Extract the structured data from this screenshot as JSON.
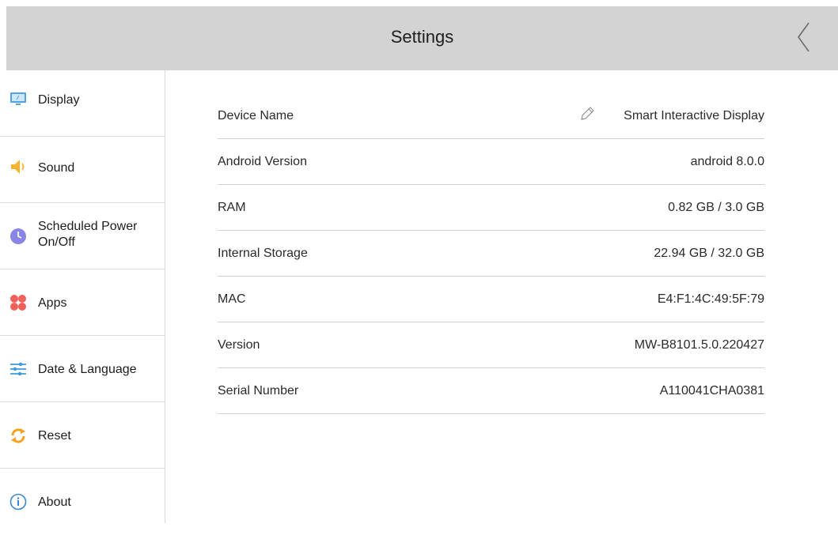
{
  "header": {
    "title": "Settings",
    "back_icon": "chevron-left-icon"
  },
  "sidebar": {
    "items": [
      {
        "label": "Display",
        "icon": "monitor-icon"
      },
      {
        "label": "Sound",
        "icon": "speaker-icon"
      },
      {
        "label": "Scheduled Power On/Off",
        "label_line1": "Scheduled Power",
        "label_line2": "On/Off",
        "icon": "clock-icon"
      },
      {
        "label": "Apps",
        "icon": "apps-icon"
      },
      {
        "label": "Date & Language",
        "icon": "sliders-icon"
      },
      {
        "label": "Reset",
        "icon": "refresh-icon"
      },
      {
        "label": "About",
        "icon": "info-icon"
      }
    ]
  },
  "about": {
    "rows": [
      {
        "key": "Device Name",
        "value": "Smart Interactive Display",
        "editable": true
      },
      {
        "key": "Android Version",
        "value": "android 8.0.0"
      },
      {
        "key": "RAM",
        "value": "0.82 GB / 3.0 GB"
      },
      {
        "key": "Internal Storage",
        "value": "22.94 GB / 32.0 GB"
      },
      {
        "key": "MAC",
        "value": "E4:F1:4C:49:5F:79"
      },
      {
        "key": "Version",
        "value": "MW-B8101.5.0.220427"
      },
      {
        "key": "Serial Number",
        "value": "A110041CHA0381"
      }
    ]
  },
  "colors": {
    "header_bg": "#d3d3d3",
    "display_icon": "#4fa3e0",
    "sound_icon": "#f6b330",
    "clock_icon": "#8a86e8",
    "apps_icon": "#f0605a",
    "sliders_icon": "#3a9be0",
    "reset_icon": "#f6a11f",
    "about_icon": "#3a86d4"
  }
}
